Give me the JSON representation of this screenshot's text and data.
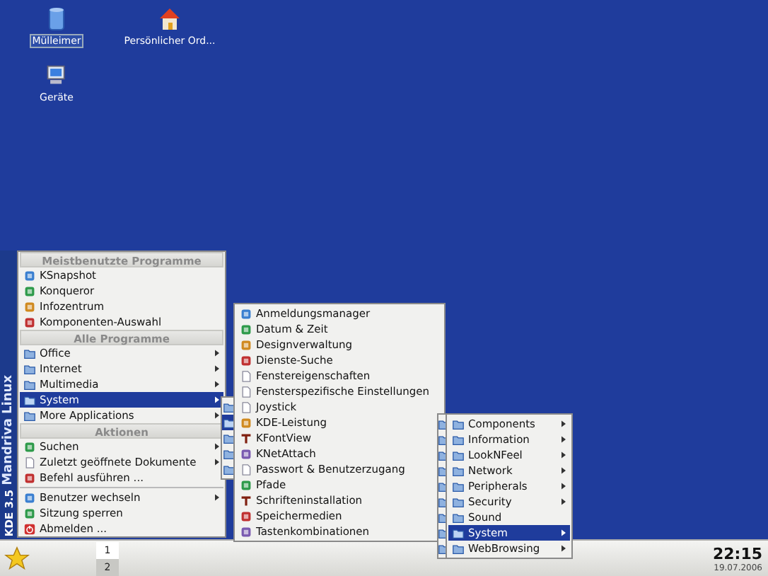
{
  "desktop_icons": [
    {
      "label": "Mülleimer",
      "kind": "trash",
      "selected": true
    },
    {
      "label": "Persönlicher Ord...",
      "kind": "home",
      "selected": false
    },
    {
      "label": "Geräte",
      "kind": "computer",
      "selected": false
    }
  ],
  "sidebar": {
    "brand": "Mandriva Linux",
    "version": "KDE 3.5"
  },
  "start_menu": [
    {
      "header": "Meistbenutzte Programme",
      "items": [
        {
          "label": "KSnapshot",
          "kind": "app",
          "submenu": false,
          "selected": false
        },
        {
          "label": "Konqueror",
          "kind": "app",
          "submenu": false,
          "selected": false
        },
        {
          "label": "Infozentrum",
          "kind": "app",
          "submenu": false,
          "selected": false
        },
        {
          "label": "Komponenten-Auswahl",
          "kind": "app",
          "submenu": false,
          "selected": false
        }
      ]
    },
    {
      "header": "Alle Programme",
      "items": [
        {
          "label": "Office",
          "kind": "folder",
          "submenu": true,
          "selected": false
        },
        {
          "label": "Internet",
          "kind": "folder",
          "submenu": true,
          "selected": false
        },
        {
          "label": "Multimedia",
          "kind": "folder",
          "submenu": true,
          "selected": false
        },
        {
          "label": "System",
          "kind": "folder",
          "submenu": true,
          "selected": true
        },
        {
          "label": "More Applications",
          "kind": "folder",
          "submenu": true,
          "selected": false
        }
      ]
    },
    {
      "header": "Aktionen",
      "items": [
        {
          "label": "Suchen",
          "kind": "app",
          "submenu": true,
          "selected": false
        },
        {
          "label": "Zuletzt geöffnete Dokumente",
          "kind": "doc",
          "submenu": true,
          "selected": false
        },
        {
          "label": "Befehl ausführen ...",
          "kind": "app",
          "submenu": false,
          "selected": false
        },
        {
          "kind": "separator"
        },
        {
          "label": "Benutzer wechseln",
          "kind": "app",
          "submenu": true,
          "selected": false
        },
        {
          "label": "Sitzung sperren",
          "kind": "app",
          "submenu": false,
          "selected": false
        },
        {
          "label": "Abmelden ...",
          "kind": "logout",
          "submenu": false,
          "selected": false
        }
      ]
    }
  ],
  "hidden_menu": [
    {
      "selected": false
    },
    {
      "selected": true
    },
    {
      "selected": false
    },
    {
      "selected": false
    },
    {
      "selected": false
    }
  ],
  "system_menu": [
    {
      "label": "Anmeldungsmanager",
      "kind": "app"
    },
    {
      "label": "Datum & Zeit",
      "kind": "app"
    },
    {
      "label": "Designverwaltung",
      "kind": "app"
    },
    {
      "label": "Dienste-Suche",
      "kind": "app"
    },
    {
      "label": "Fenstereigenschaften",
      "kind": "doc"
    },
    {
      "label": "Fensterspezifische Einstellungen",
      "kind": "doc"
    },
    {
      "label": "Joystick",
      "kind": "doc"
    },
    {
      "label": "KDE-Leistung",
      "kind": "app"
    },
    {
      "label": "KFontView",
      "kind": "font"
    },
    {
      "label": "KNetAttach",
      "kind": "app"
    },
    {
      "label": "Passwort & Benutzerzugang",
      "kind": "doc"
    },
    {
      "label": "Pfade",
      "kind": "app"
    },
    {
      "label": "Schrifteninstallation",
      "kind": "font"
    },
    {
      "label": "Speichermedien",
      "kind": "app"
    },
    {
      "label": "Tastenkombinationen",
      "kind": "app"
    }
  ],
  "config_menu": [
    {
      "label": "Components",
      "submenu": true,
      "selected": false
    },
    {
      "label": "Information",
      "submenu": true,
      "selected": false
    },
    {
      "label": "LookNFeel",
      "submenu": true,
      "selected": false
    },
    {
      "label": "Network",
      "submenu": true,
      "selected": false
    },
    {
      "label": "Peripherals",
      "submenu": true,
      "selected": false
    },
    {
      "label": "Security",
      "submenu": true,
      "selected": false
    },
    {
      "label": "Sound",
      "submenu": false,
      "selected": false
    },
    {
      "label": "System",
      "submenu": true,
      "selected": true
    },
    {
      "label": "WebBrowsing",
      "submenu": true,
      "selected": false
    }
  ],
  "taskbar": {
    "desktops": [
      {
        "label": "1",
        "selected": false
      },
      {
        "label": "2",
        "selected": true
      }
    ],
    "clock": "22:15",
    "date": "19.07.2006"
  }
}
